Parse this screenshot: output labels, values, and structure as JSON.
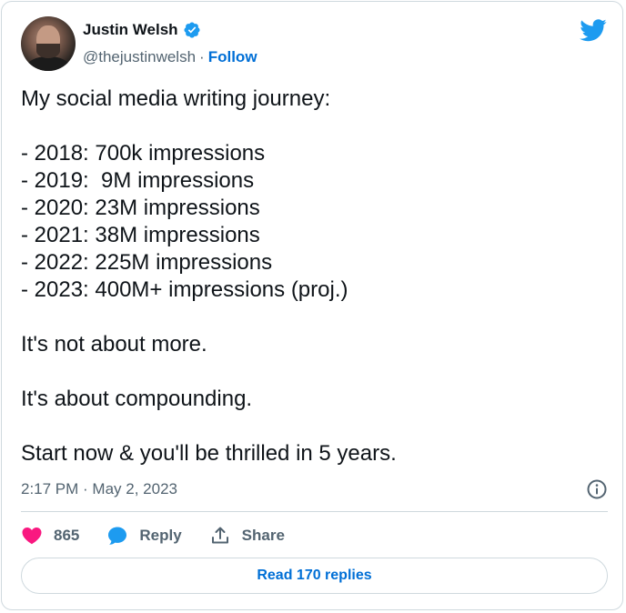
{
  "author": {
    "name": "Justin Welsh",
    "handle": "@thejustinwelsh",
    "separator": "·",
    "follow_label": "Follow",
    "verified": true
  },
  "tweet": {
    "text": "My social media writing journey:\n\n- 2018: 700k impressions\n- 2019:  9M impressions\n- 2020: 23M impressions\n- 2021: 38M impressions\n- 2022: 225M impressions\n- 2023: 400M+ impressions (proj.)\n\nIt's not about more.\n\nIt's about compounding.\n\nStart now & you'll be thrilled in 5 years.",
    "timestamp": "2:17 PM · May 2, 2023"
  },
  "actions": {
    "like_count": "865",
    "reply_label": "Reply",
    "share_label": "Share"
  },
  "replies_button_label": "Read 170 replies",
  "icons": {
    "brand": "twitter-bird-icon",
    "verified": "verified-badge-icon",
    "info": "info-icon",
    "like": "heart-icon",
    "reply": "speech-bubble-icon",
    "share": "share-upload-icon"
  },
  "colors": {
    "brand_blue": "#1d9bf0",
    "link_blue": "#006fd6",
    "like_pink": "#f91880",
    "text_primary": "#0f1419",
    "text_secondary": "#536471",
    "border": "#cfd9de"
  }
}
